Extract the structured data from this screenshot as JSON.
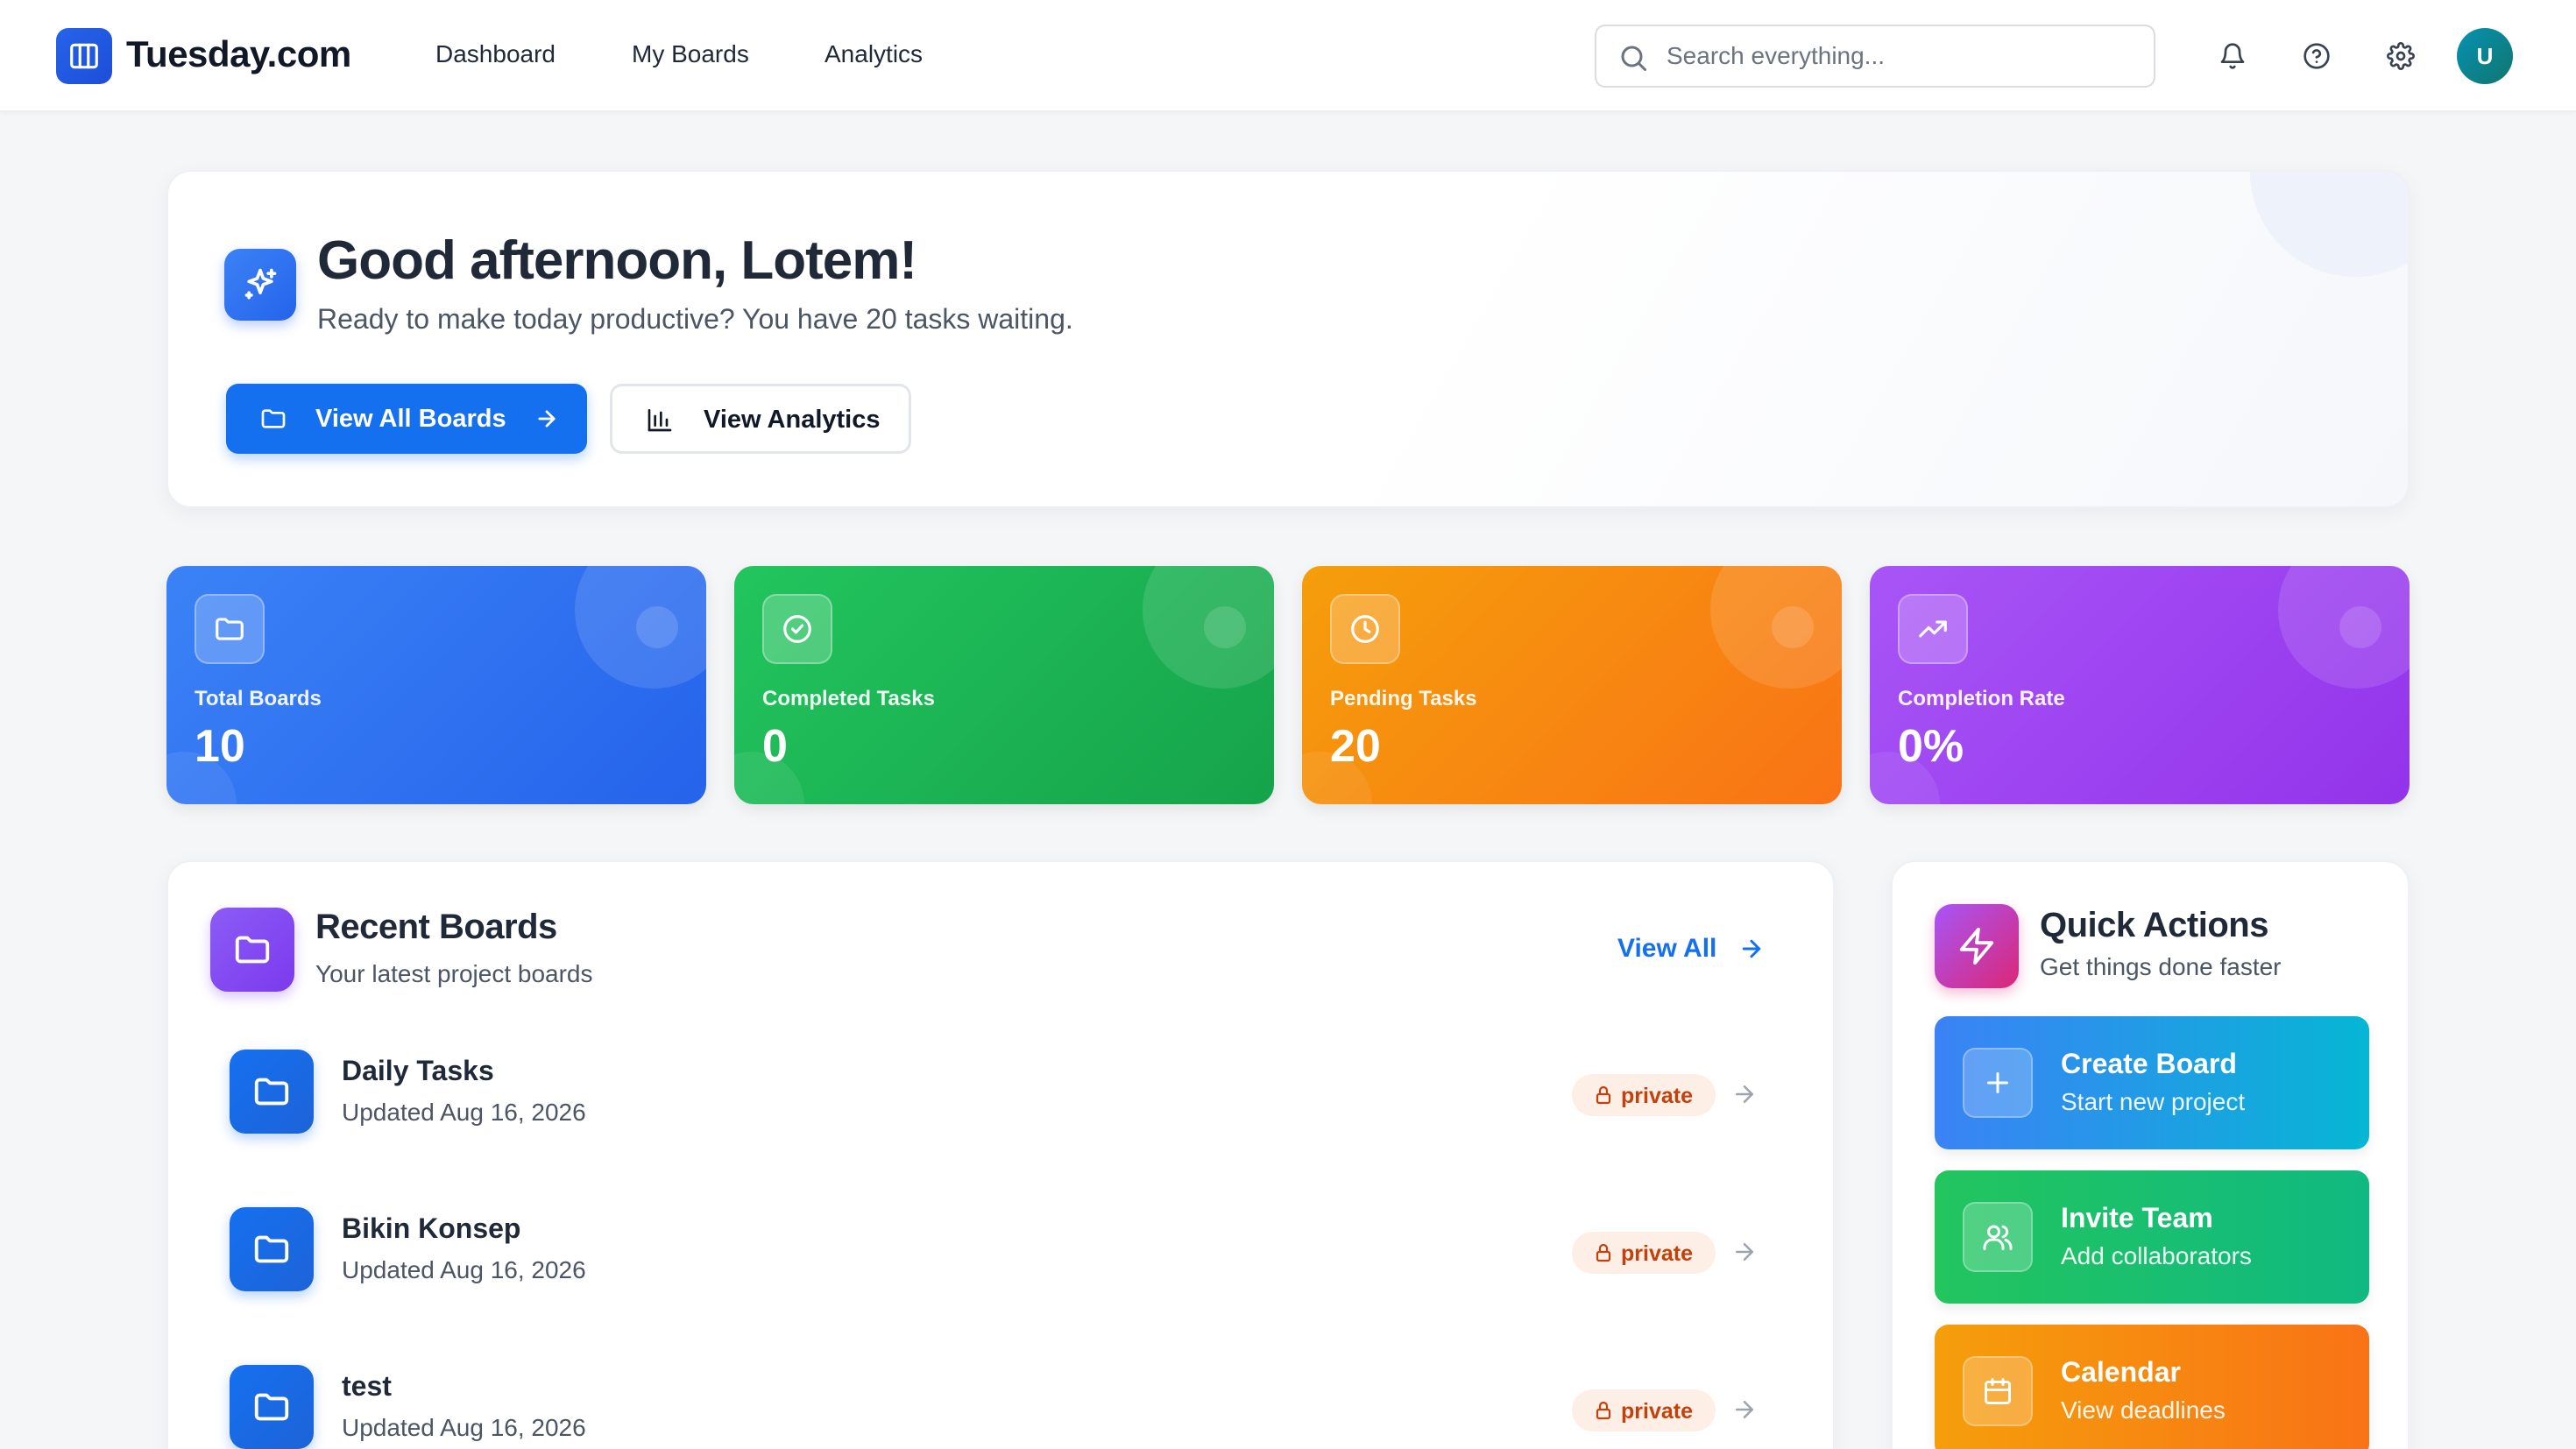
{
  "app": {
    "brand": "Tuesday.com",
    "avatar_initial": "U"
  },
  "nav": {
    "items": [
      {
        "label": "Dashboard"
      },
      {
        "label": "My Boards"
      },
      {
        "label": "Analytics"
      }
    ]
  },
  "search": {
    "placeholder": "Search everything...",
    "value": ""
  },
  "hero": {
    "title": "Good afternoon, Lotem!",
    "subtitle": "Ready to make today productive? You have 20 tasks waiting.",
    "primary_button": "View All Boards",
    "secondary_button": "View Analytics"
  },
  "stats": [
    {
      "label": "Total Boards",
      "value": "10",
      "icon": "folder-icon",
      "color_from": "#3b82f6",
      "color_to": "#2563eb"
    },
    {
      "label": "Completed Tasks",
      "value": "0",
      "icon": "check-circle-icon",
      "color_from": "#22c55e",
      "color_to": "#16a34a"
    },
    {
      "label": "Pending Tasks",
      "value": "20",
      "icon": "clock-icon",
      "color_from": "#f59e0b",
      "color_to": "#f97316"
    },
    {
      "label": "Completion Rate",
      "value": "0%",
      "icon": "trending-up-icon",
      "color_from": "#a855f7",
      "color_to": "#9333ea"
    }
  ],
  "recent": {
    "title": "Recent Boards",
    "subtitle": "Your latest project boards",
    "view_all": "View All",
    "boards": [
      {
        "name": "Daily Tasks",
        "updated": "Updated Aug 16, 2026",
        "visibility": "private"
      },
      {
        "name": "Bikin Konsep",
        "updated": "Updated Aug 16, 2026",
        "visibility": "private"
      },
      {
        "name": "test",
        "updated": "Updated Aug 16, 2026",
        "visibility": "private"
      }
    ]
  },
  "quick": {
    "title": "Quick Actions",
    "subtitle": "Get things done faster",
    "actions": [
      {
        "title": "Create Board",
        "subtitle": "Start new project",
        "icon": "plus-icon",
        "color_from": "#3b82f6",
        "color_to": "#06b6d4"
      },
      {
        "title": "Invite Team",
        "subtitle": "Add collaborators",
        "icon": "users-icon",
        "color_from": "#22c55e",
        "color_to": "#10b981"
      },
      {
        "title": "Calendar",
        "subtitle": "View deadlines",
        "icon": "calendar-icon",
        "color_from": "#f59e0b",
        "color_to": "#f97316"
      }
    ]
  },
  "colors": {
    "primary": "#1570ef",
    "badge_bg": "#fdefe6",
    "badge_text": "#c2410c"
  }
}
